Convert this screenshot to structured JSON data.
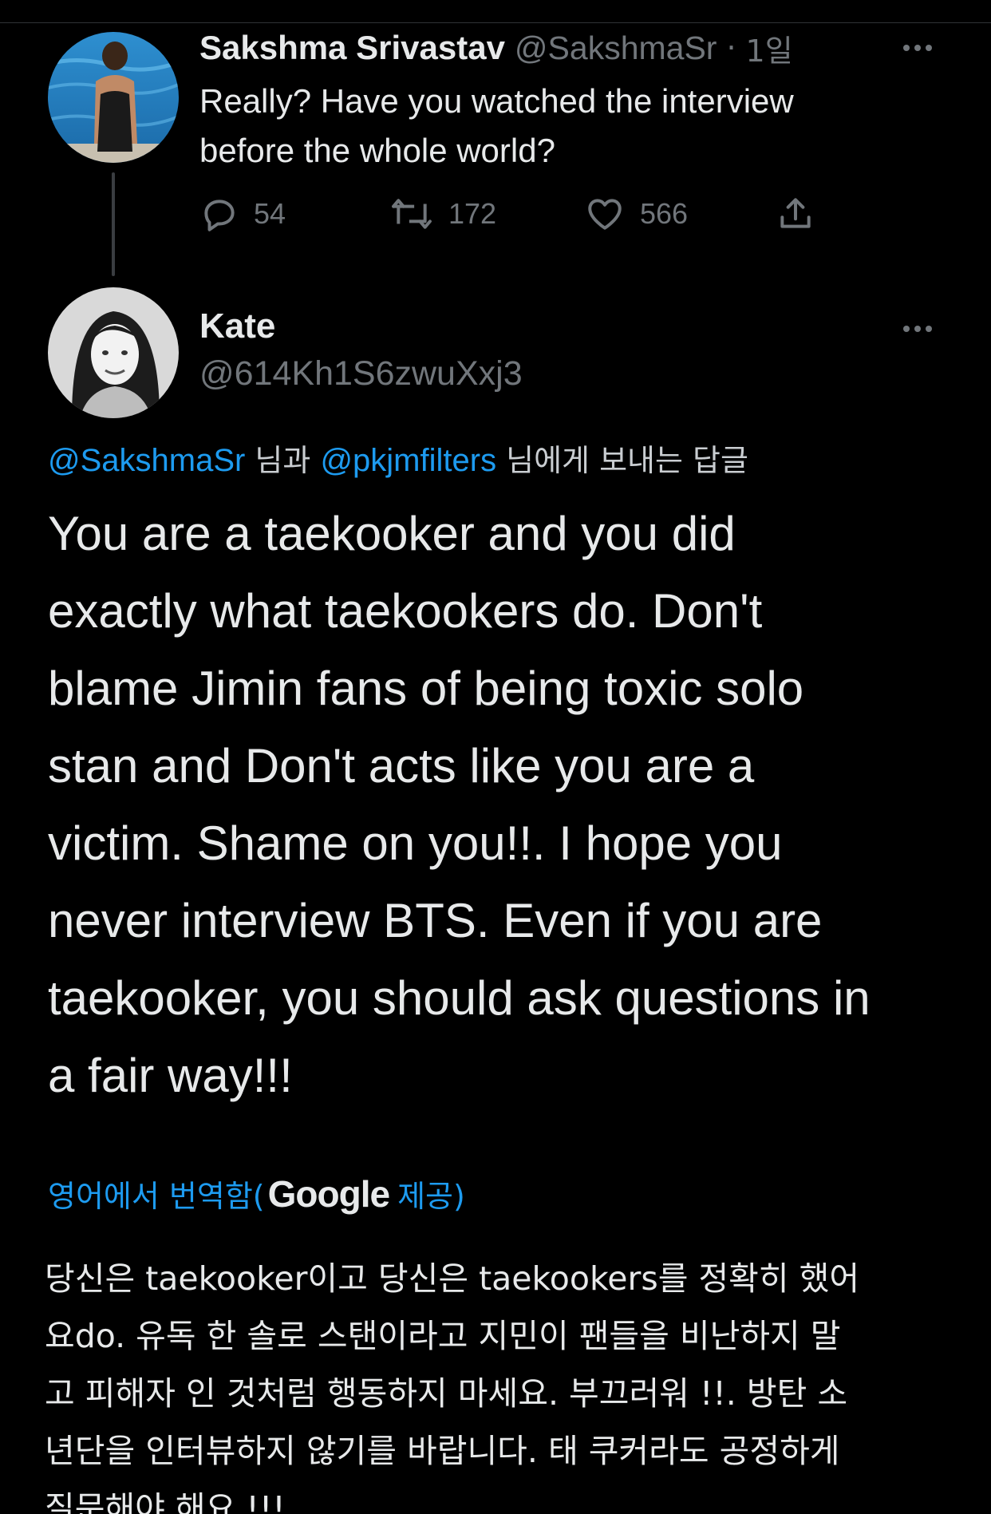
{
  "parent_tweet": {
    "author_name": "Sakshma Srivastav",
    "author_handle": "@SakshmaSr",
    "separator": "·",
    "time": "1일",
    "text_lines": [
      "Really? Have you watched the interview",
      "before the whole world?"
    ],
    "replies": "54",
    "retweets": "172",
    "likes": "566"
  },
  "main_tweet": {
    "author_name": "Kate",
    "author_handle": "@614Kh1S6zwuXxj3",
    "reply_to": {
      "mention_1": "@SakshmaSr",
      "connector": " 님과 ",
      "mention_2": "@pkjmfilters",
      "suffix": " 님에게 보내는 답글"
    },
    "text_lines": [
      "You are a taekooker and you did",
      "exactly what taekookers do. Don't",
      "blame Jimin fans of being toxic solo",
      "stan and Don't acts like you are a",
      "victim. Shame on you!!. I hope you",
      "never interview BTS. Even if you are",
      "taekooker, you should ask questions in",
      "a fair way!!!"
    ],
    "translate": {
      "prefix": "영어에서 번역함(",
      "provider": "Google",
      "suffix": " 제공)"
    },
    "translation_lines": [
      "당신은 taekooker이고 당신은 taekookers를 정확히 했어",
      "요do. 유독 한 솔로 스탠이라고 지민이 팬들을 비난하지 말",
      "고 피해자 인 것처럼 행동하지 마세요. 부끄러워 !!. 방탄 소",
      "년단을 인터뷰하지 않기를 바랍니다. 태 쿠커라도 공정하게",
      "질문해야 해요 !!!"
    ]
  },
  "icons": {
    "reply": "reply-icon",
    "retweet": "retweet-icon",
    "like": "heart-icon",
    "share": "share-icon",
    "more": "more-icon"
  },
  "colors": {
    "background": "#000000",
    "text": "#e7e9ea",
    "secondary": "#71767b",
    "link": "#1d9bf0"
  }
}
